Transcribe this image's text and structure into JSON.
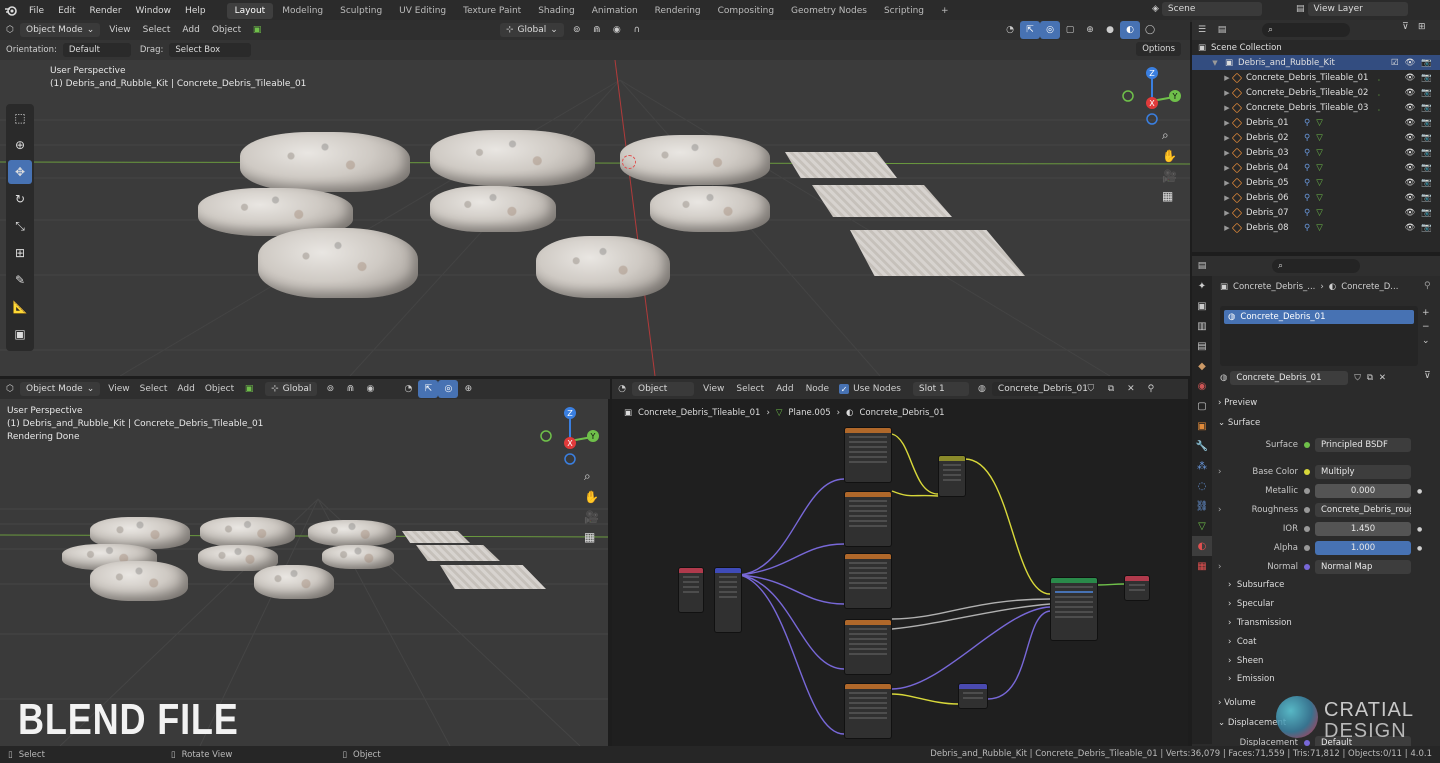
{
  "topbar": {
    "menus": [
      "File",
      "Edit",
      "Render",
      "Window",
      "Help"
    ],
    "workspaces": [
      "Layout",
      "Modeling",
      "Sculpting",
      "UV Editing",
      "Texture Paint",
      "Shading",
      "Animation",
      "Rendering",
      "Compositing",
      "Geometry Nodes",
      "Scripting"
    ],
    "active_workspace": "Layout",
    "add_tab": "+",
    "scene": "Scene",
    "view_layer": "View Layer"
  },
  "viewport_top": {
    "mode": "Object Mode",
    "menus": [
      "View",
      "Select",
      "Add",
      "Object"
    ],
    "transform": "Global",
    "orientation_label": "Orientation:",
    "orientation_value": "Default",
    "drag_label": "Drag:",
    "drag_value": "Select Box",
    "options": "Options",
    "perspective": "User Perspective",
    "context": "(1) Debris_and_Rubble_Kit | Concrete_Debris_Tileable_01",
    "gizmo": {
      "z": "Z",
      "y": "Y",
      "x": "X"
    }
  },
  "viewport_bottom": {
    "mode": "Object Mode",
    "menus": [
      "View",
      "Select",
      "Add",
      "Object"
    ],
    "transform": "Global",
    "perspective": "User Perspective",
    "context": "(1) Debris_and_Rubble_Kit | Concrete_Debris_Tileable_01",
    "status": "Rendering Done",
    "watermark": "BLEND FILE",
    "gizmo": {
      "z": "Z",
      "y": "Y",
      "x": "X"
    }
  },
  "node_editor": {
    "type": "Object",
    "menus": [
      "View",
      "Select",
      "Add",
      "Node"
    ],
    "use_nodes_label": "Use Nodes",
    "slot": "Slot 1",
    "material": "Concrete_Debris_01",
    "breadcrumb": [
      "Concrete_Debris_Tileable_01",
      "Plane.005",
      "Concrete_Debris_01"
    ]
  },
  "outliner": {
    "root": "Scene Collection",
    "collection": "Debris_and_Rubble_Kit",
    "items": [
      "Concrete_Debris_Tileable_01",
      "Concrete_Debris_Tileable_02",
      "Concrete_Debris_Tileable_03",
      "Debris_01",
      "Debris_02",
      "Debris_03",
      "Debris_04",
      "Debris_05",
      "Debris_06",
      "Debris_07",
      "Debris_08"
    ]
  },
  "properties": {
    "breadcrumb_object": "Concrete_Debris_...",
    "breadcrumb_material": "Concrete_D...",
    "slot_item": "Concrete_Debris_01",
    "material_name": "Concrete_Debris_01",
    "sections": {
      "preview": "Preview",
      "surface": "Surface",
      "volume": "Volume",
      "displacement": "Displacement"
    },
    "rows": {
      "surface_label": "Surface",
      "surface_value": "Principled BSDF",
      "base_color_label": "Base Color",
      "base_color_value": "Multiply",
      "metallic_label": "Metallic",
      "metallic_value": "0.000",
      "roughness_label": "Roughness",
      "roughness_value": "Concrete_Debris_roug...",
      "ior_label": "IOR",
      "ior_value": "1.450",
      "alpha_label": "Alpha",
      "alpha_value": "1.000",
      "normal_label": "Normal",
      "normal_value": "Normal Map",
      "displacement_label": "Displacement",
      "displacement_value": "Default"
    },
    "subsections": [
      "Subsurface",
      "Specular",
      "Transmission",
      "Coat",
      "Sheen",
      "Emission"
    ]
  },
  "statusbar": {
    "select": "Select",
    "rotate": "Rotate View",
    "object": "Object",
    "info": "Debris_and_Rubble_Kit | Concrete_Debris_Tileable_01 | Verts:36,079 | Faces:71,559 | Tris:71,812 | Objects:0/11 | 4.0.1"
  },
  "watermark_logo": {
    "line1": "CRATIAL",
    "line2": "DESIGN"
  },
  "colors": {
    "accent": "#4772b3",
    "selection": "#334d80",
    "x_axis": "#e03b3b",
    "y_axis": "#6fc04a",
    "z_axis": "#3a7fe0"
  }
}
